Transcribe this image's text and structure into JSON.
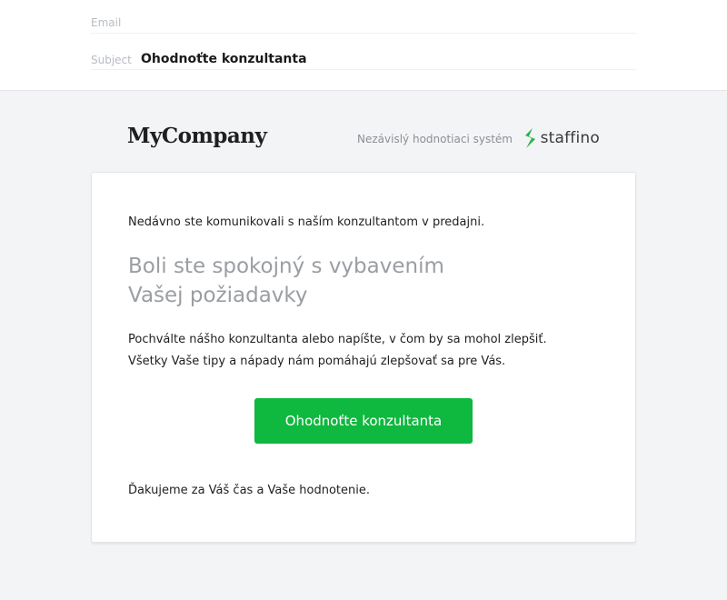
{
  "email_header": {
    "email_label": "Email",
    "subject_label": "Subject",
    "subject_value": "Ohodnoťte konzultanta"
  },
  "brand": {
    "company_logo": "MyCompany",
    "tagline": "Nezávislý hodnotiaci systém",
    "staffino_logo": "staffino"
  },
  "message": {
    "intro": "Nedávno ste komunikovali s naším konzultantom v predajni.",
    "headline_line1": "Boli ste spokojný s vybavením",
    "headline_line2": "Vašej požiadavky",
    "body_line1": "Pochválte nášho konzultanta alebo napíšte, v čom by sa mohol zlepšiť.",
    "body_line2": "Všetky Vaše tipy a nápady nám pomáhajú zlepšovať sa pre Vás.",
    "cta_label": "Ohodnoťte konzultanta",
    "thanks": "Ďakujeme za Váš čas a Vaše hodnotenie."
  },
  "colors": {
    "cta_background": "#0fb83f",
    "staffino_green": "#2bb34a",
    "headline_gray": "#9a9ea3",
    "page_background": "#f3f4f6"
  }
}
